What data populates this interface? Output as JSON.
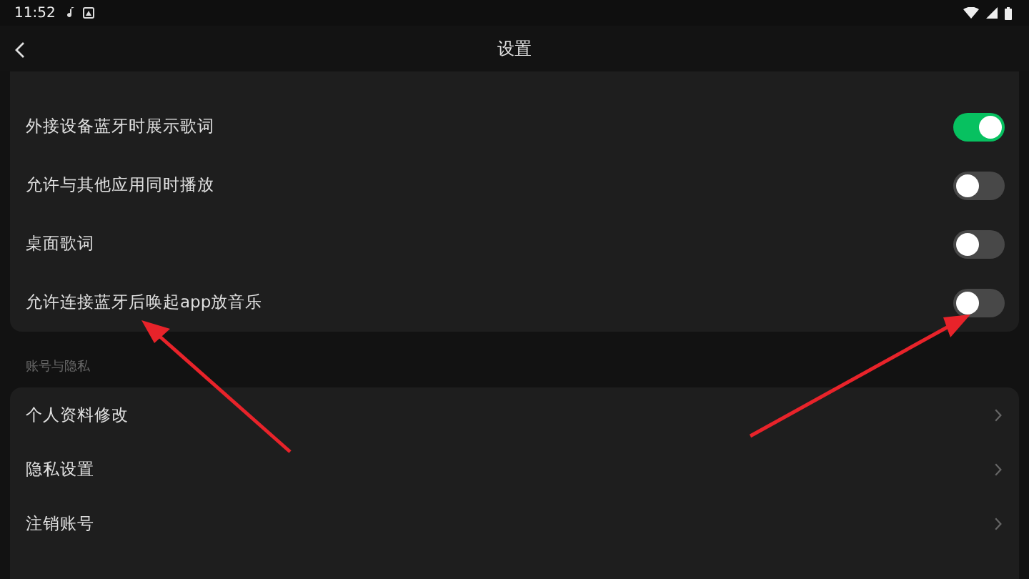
{
  "status_bar": {
    "time": "11:52"
  },
  "app_bar": {
    "title": "设置"
  },
  "toggle_settings": [
    {
      "label": "外接设备蓝牙时展示歌词",
      "on": true
    },
    {
      "label": "允许与其他应用同时播放",
      "on": false
    },
    {
      "label": "桌面歌词",
      "on": false
    },
    {
      "label": "允许连接蓝牙后唤起app放音乐",
      "on": false
    }
  ],
  "section": {
    "title": "账号与隐私"
  },
  "account_items": [
    {
      "label": "个人资料修改"
    },
    {
      "label": "隐私设置"
    },
    {
      "label": "注销账号"
    }
  ]
}
